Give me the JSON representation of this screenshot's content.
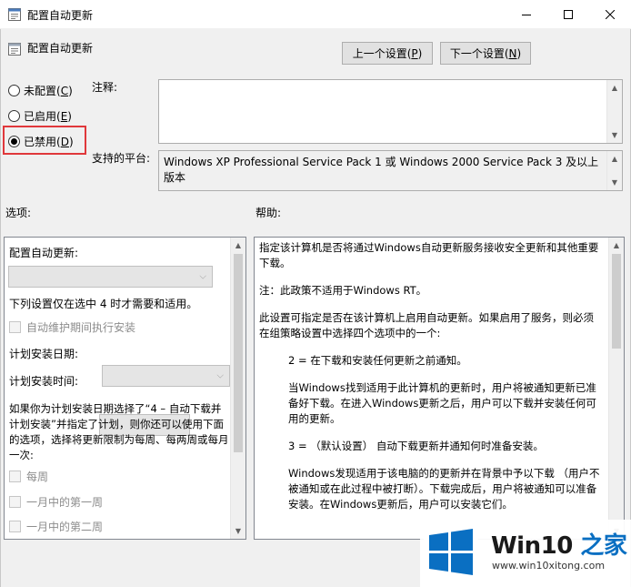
{
  "window": {
    "title": "配置自动更新",
    "controls": {
      "minimize": "minimize-icon",
      "maximize": "maximize-icon",
      "close": "close-icon"
    }
  },
  "header": {
    "title": "配置自动更新",
    "prev_button": {
      "text": "上一个设置(",
      "key": "P",
      "suffix": ")"
    },
    "next_button": {
      "text": "下一个设置(",
      "key": "N",
      "suffix": ")"
    }
  },
  "state_options": [
    {
      "text": "未配置(",
      "key": "C",
      "suffix": ")",
      "checked": false
    },
    {
      "text": "已启用(",
      "key": "E",
      "suffix": ")",
      "checked": false
    },
    {
      "text": "已禁用(",
      "key": "D",
      "suffix": ")",
      "checked": true
    }
  ],
  "comment": {
    "label": "注释:",
    "value": ""
  },
  "platform": {
    "label": "支持的平台:",
    "value": "Windows XP Professional Service Pack 1 或 Windows 2000 Service Pack 3 及以上版本"
  },
  "options": {
    "label": "选项:",
    "configure_label": "配置自动更新:",
    "configure_value": "",
    "note": "下列设置仅在选中 4 时才需要和适用。",
    "maintenance_checkbox": "自动维护期间执行安装",
    "schedule_day_label": "计划安装日期:",
    "schedule_day_value": "",
    "schedule_time_label": "计划安装时间:",
    "schedule_time_value": "",
    "schedule_desc": "如果你为计划安装日期选择了“4 – 自动下载并计划安装”并指定了计划，则你还可以使用下面的选项，选择将更新限制为每周、每两周或每月一次:",
    "weekly_checkbox": "每周",
    "first_week_checkbox": "一月中的第一周",
    "second_week_checkbox": "一月中的第二周"
  },
  "help": {
    "label": "帮助:",
    "paragraphs": [
      "指定该计算机是否将通过Windows自动更新服务接收安全更新和其他重要下载。",
      "注：此政策不适用于Windows RT。",
      "此设置可指定是否在该计算机上启用自动更新。如果启用了服务，则必须在组策略设置中选择四个选项中的一个:",
      "2 = 在下载和安装任何更新之前通知。",
      "当Windows找到适用于此计算机的更新时，用户将被通知更新已准备好下载。在进入Windows更新之后，用户可以下载并安装任何可用的更新。",
      "3 = （默认设置） 自动下载更新并通知何时准备安装。",
      "Windows发现适用于该电脑的的更新并在背景中予以下载 （用户不被通知或在此过程中被打断）。下载完成后，用户将被通知可以准备安装。在Windows更新后，用户可以安装它们。"
    ]
  },
  "watermark": {
    "brand_prefix": "Win10",
    "brand_suffix": " 之家",
    "url": "www.win10xitong.com",
    "colors": {
      "blue": "#0a6fc2"
    }
  },
  "colors": {
    "highlight_border": "#e0383b",
    "dialog_bg": "#f0f0f0"
  }
}
